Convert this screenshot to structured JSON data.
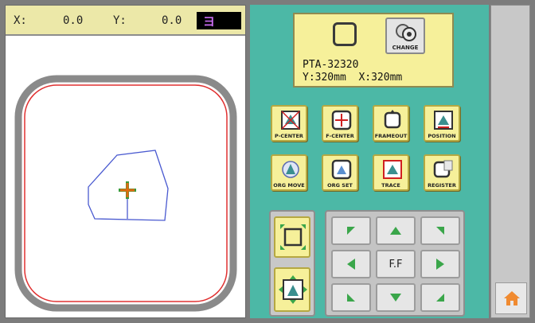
{
  "coordinates": {
    "x_label": "X:",
    "x_value": "0.0",
    "y_label": "Y:",
    "y_value": "0.0",
    "badge_text": "ヨ"
  },
  "hoop": {
    "change_label": "CHANGE",
    "model": "PTA-32320",
    "size": "Y:320mm  X:320mm"
  },
  "function_buttons": [
    {
      "label": "P-CENTER",
      "icon": "p-center-icon"
    },
    {
      "label": "F-CENTER",
      "icon": "f-center-icon"
    },
    {
      "label": "FRAMEOUT",
      "icon": "frameout-icon"
    },
    {
      "label": "POSITION",
      "icon": "position-icon"
    },
    {
      "label": "ORG MOVE",
      "icon": "org-move-icon"
    },
    {
      "label": "ORG SET",
      "icon": "org-set-icon"
    },
    {
      "label": "TRACE",
      "icon": "trace-icon"
    },
    {
      "label": "REGISTER",
      "icon": "register-icon"
    }
  ],
  "jog": {
    "center_label": "F.F"
  },
  "home": {
    "icon": "home-icon"
  },
  "colors": {
    "hoop_inner": "#e03030",
    "hoop_outer": "#808080",
    "design_outline": "#4a5ad0",
    "cursor": "#e06a10",
    "accent_green": "#3aa64a"
  }
}
